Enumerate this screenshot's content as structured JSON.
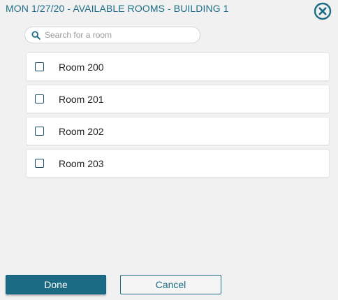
{
  "dialog": {
    "title": "MON 1/27/20 - AVAILABLE ROOMS - BUILDING 1",
    "close_icon": "close-circle-icon"
  },
  "search": {
    "placeholder": "Search for a room",
    "value": "",
    "icon": "search-icon"
  },
  "rooms": [
    {
      "label": "Room 200",
      "checked": false
    },
    {
      "label": "Room 201",
      "checked": false
    },
    {
      "label": "Room 202",
      "checked": false
    },
    {
      "label": "Room 203",
      "checked": false
    }
  ],
  "actions": {
    "done_label": "Done",
    "cancel_label": "Cancel"
  },
  "colors": {
    "accent": "#1b6b84",
    "background": "#f1f1f1"
  }
}
